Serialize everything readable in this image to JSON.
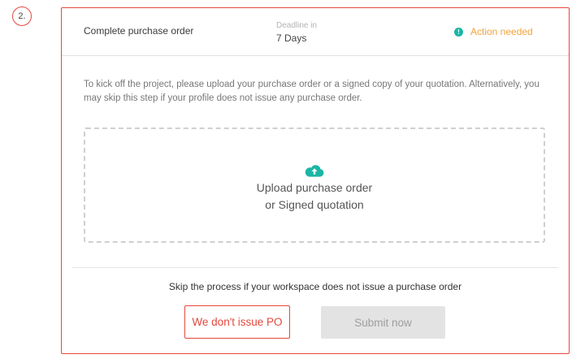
{
  "step": {
    "number": "2."
  },
  "card": {
    "title": "Complete purchase order",
    "deadline_label": "Deadline in",
    "deadline_value": "7 Days",
    "status_icon": "alert-circle-icon",
    "status_text": "Action needed"
  },
  "instructions": "To kick off the project, please upload your purchase order or a signed copy of your quotation. Alternatively, you may skip this step if your profile does not issue any purchase order.",
  "dropzone": {
    "icon": "cloud-upload-icon",
    "line1": "Upload purchase order",
    "line2": "or Signed quotation"
  },
  "footer": {
    "skip_note": "Skip the process if your workspace does not issue a purchase order",
    "skip_button": "We don't issue PO",
    "submit_button": "Submit now"
  },
  "colors": {
    "accent_red": "#e5473c",
    "warning_orange": "#f2a33a",
    "teal": "#1bb5a6",
    "disabled_gray": "#e3e3e3"
  }
}
